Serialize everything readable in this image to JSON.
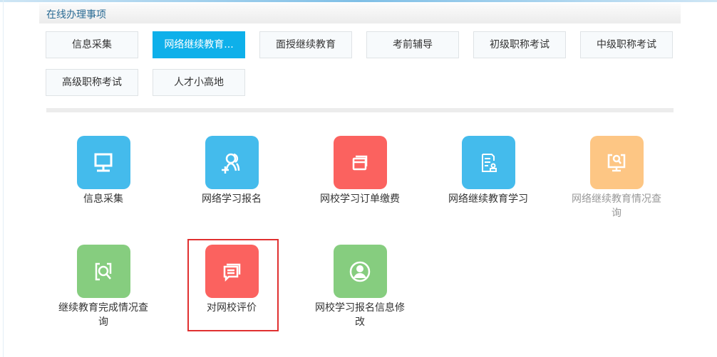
{
  "header": {
    "title": "在线办理事项"
  },
  "tabs": [
    {
      "label": "信息采集",
      "active": false
    },
    {
      "label": "网络继续教育...",
      "active": true
    },
    {
      "label": "面授继续教育",
      "active": false
    },
    {
      "label": "考前辅导",
      "active": false
    },
    {
      "label": "初级职称考试",
      "active": false
    },
    {
      "label": "中级职称考试",
      "active": false
    },
    {
      "label": "高级职称考试",
      "active": false
    },
    {
      "label": "人才小高地",
      "active": false
    }
  ],
  "items": [
    {
      "label": "信息采集",
      "icon": "monitor-icon",
      "color": "#44bbec"
    },
    {
      "label": "网络学习报名",
      "icon": "add-user-icon",
      "color": "#44bbec"
    },
    {
      "label": "网校学习订单缴费",
      "icon": "card-icon",
      "color": "#fb625f"
    },
    {
      "label": "网络继续教育学习",
      "icon": "document-stamp-icon",
      "color": "#44bbec"
    },
    {
      "label": "网络继续教育情况查询",
      "icon": "monitor-search-icon",
      "color": "#fdc684"
    },
    {
      "label": "继续教育完成情况查询",
      "icon": "search-icon",
      "color": "#86cd7f"
    },
    {
      "label": "对网校评价",
      "icon": "chat-icon",
      "color": "#fb625f"
    },
    {
      "label": "网校学习报名信息修改",
      "icon": "user-circle-icon",
      "color": "#86cd7f"
    }
  ]
}
